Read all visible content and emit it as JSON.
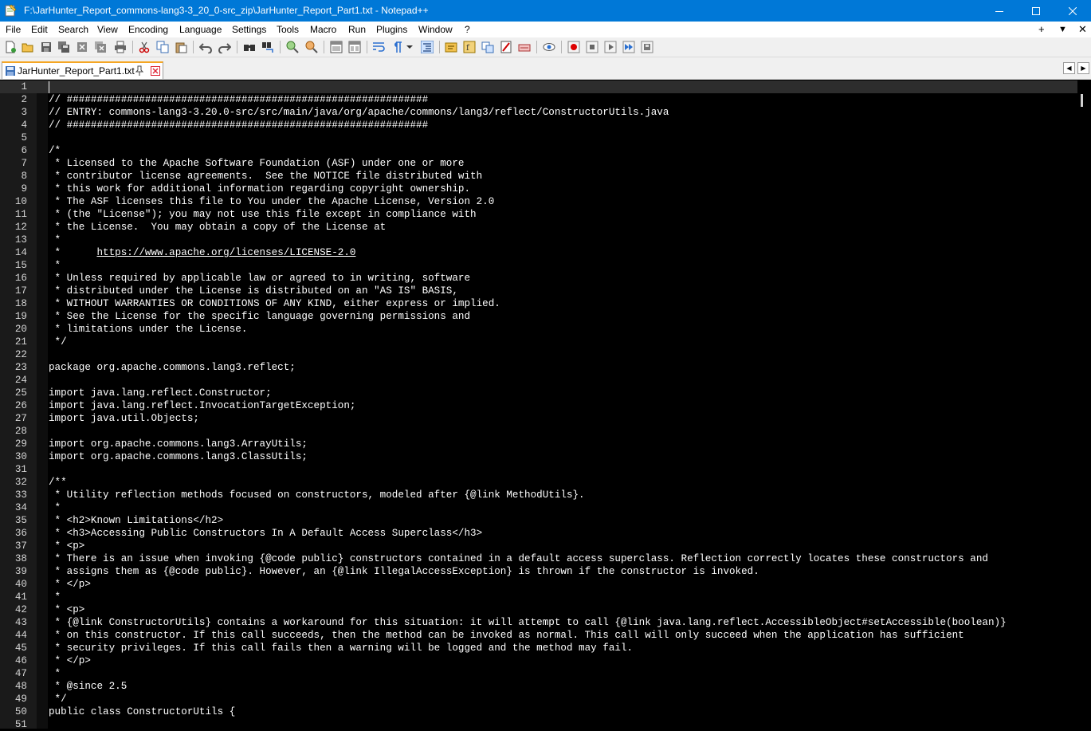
{
  "window": {
    "title": "F:\\JarHunter_Report_commons-lang3-3_20_0-src_zip\\JarHunter_Report_Part1.txt - Notepad++",
    "minimize_icon": "minimize-icon",
    "maximize_icon": "maximize-icon",
    "close_icon": "close-icon"
  },
  "menu": {
    "items": [
      "File",
      "Edit",
      "Search",
      "View",
      "Encoding",
      "Language",
      "Settings",
      "Tools",
      "Macro",
      "Run",
      "Plugins",
      "Window",
      "?"
    ],
    "right": [
      "+",
      "▼",
      "✕"
    ]
  },
  "toolbar": {
    "icons": [
      "new-file-icon",
      "open-file-icon",
      "save-icon",
      "save-all-icon",
      "close-icon",
      "close-all-icon",
      "print-icon",
      "cut-icon",
      "copy-icon",
      "paste-icon",
      "undo-icon",
      "redo-icon",
      "find-icon",
      "replace-icon",
      "zoom-in-icon",
      "zoom-out-icon",
      "sync-vertical-icon",
      "sync-horizontal-icon",
      "word-wrap-icon",
      "show-all-chars-icon",
      "indent-guide-icon",
      "language-icon",
      "function-list-icon",
      "folder-workspace-icon",
      "document-map-icon",
      "monitoring-icon",
      "macro-record-icon",
      "macro-stop-icon",
      "macro-play-icon",
      "macro-run-multiple-icon",
      "macro-save-icon"
    ]
  },
  "tabs": [
    {
      "label": "JarHunter_Report_Part1.txt"
    }
  ],
  "editor": {
    "lines": [
      "",
      "// ############################################################",
      "// ENTRY: commons-lang3-3.20.0-src/src/main/java/org/apache/commons/lang3/reflect/ConstructorUtils.java",
      "// ############################################################",
      "",
      "/*",
      " * Licensed to the Apache Software Foundation (ASF) under one or more",
      " * contributor license agreements.  See the NOTICE file distributed with",
      " * this work for additional information regarding copyright ownership.",
      " * The ASF licenses this file to You under the Apache License, Version 2.0",
      " * (the \"License\"); you may not use this file except in compliance with",
      " * the License.  You may obtain a copy of the License at",
      " *",
      " *      https://www.apache.org/licenses/LICENSE-2.0",
      " *",
      " * Unless required by applicable law or agreed to in writing, software",
      " * distributed under the License is distributed on an \"AS IS\" BASIS,",
      " * WITHOUT WARRANTIES OR CONDITIONS OF ANY KIND, either express or implied.",
      " * See the License for the specific language governing permissions and",
      " * limitations under the License.",
      " */",
      "",
      "package org.apache.commons.lang3.reflect;",
      "",
      "import java.lang.reflect.Constructor;",
      "import java.lang.reflect.InvocationTargetException;",
      "import java.util.Objects;",
      "",
      "import org.apache.commons.lang3.ArrayUtils;",
      "import org.apache.commons.lang3.ClassUtils;",
      "",
      "/**",
      " * Utility reflection methods focused on constructors, modeled after {@link MethodUtils}.",
      " *",
      " * <h2>Known Limitations</h2>",
      " * <h3>Accessing Public Constructors In A Default Access Superclass</h3>",
      " * <p>",
      " * There is an issue when invoking {@code public} constructors contained in a default access superclass. Reflection correctly locates these constructors and",
      " * assigns them as {@code public}. However, an {@link IllegalAccessException} is thrown if the constructor is invoked.",
      " * </p>",
      " *",
      " * <p>",
      " * {@link ConstructorUtils} contains a workaround for this situation: it will attempt to call {@link java.lang.reflect.AccessibleObject#setAccessible(boolean)}",
      " * on this constructor. If this call succeeds, then the method can be invoked as normal. This call will only succeed when the application has sufficient",
      " * security privileges. If this call fails then a warning will be logged and the method may fail.",
      " * </p>",
      " *",
      " * @since 2.5",
      " */",
      "public class ConstructorUtils {",
      ""
    ],
    "url": "https://www.apache.org/licenses/LICENSE-2.0"
  }
}
